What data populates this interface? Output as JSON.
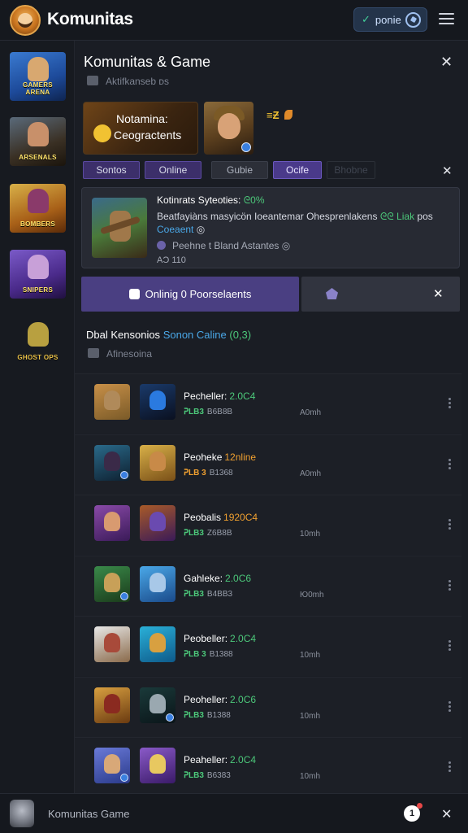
{
  "app": {
    "brand_name": "Komunitas",
    "pill_label": "ponie",
    "pill_check": "✓",
    "accent": "#4a3f82",
    "green": "#4cc87a",
    "blue": "#4aa8e8",
    "orange": "#f0a030"
  },
  "rail": {
    "items": [
      {
        "caption": "GAMERS ARENA",
        "icon": "game-thumb-icon"
      },
      {
        "caption": "ARSENALS",
        "icon": "soldier-thumb-icon"
      },
      {
        "caption": "BOMBERS",
        "icon": "warrior-thumb-icon"
      },
      {
        "caption": "SNIPERS",
        "icon": "knight-thumb-icon"
      },
      {
        "caption": "GHOST OPS",
        "icon": "mascot-thumb-icon"
      }
    ]
  },
  "panel": {
    "title": "Komunitas & Game",
    "subtitle": "Aktifkanseb ᴅs",
    "banner_line1": "Notamina:",
    "banner_line2": "Ceogractents",
    "hero_tags": "≡Ƶ",
    "chips": [
      "Sontos",
      "Online",
      "Gubie",
      "Ocife",
      "Bhobne"
    ],
    "feature": {
      "title_pre": "Kotinrats Syteoties:",
      "title_hl": "ᘓ0%",
      "desc_pre": "Beatfayiàns masyicön Ioeantemar Ohesprenlakens",
      "desc_hl": "ᘓᘓ Liak",
      "desc_mid": "pos",
      "desc_link": "Coeaent",
      "desc_tail": "◎",
      "meta": "Peehne t Bland Astantes ◎",
      "count": "AƆ 110"
    },
    "cta_label": "Onlinig 0 Poorselaents",
    "list_head_pre": "Dbal Kensonios",
    "list_head_blue": "Sonon Caline",
    "list_head_green": "(0,3)",
    "list_sub": "Afinesoina"
  },
  "list": {
    "rows": [
      {
        "name": "Pecheller:",
        "status": "2.0C4",
        "status_color": "#4cc87a",
        "v1": "ᕈLB3",
        "v2": "B6B8B",
        "time": "A0mh"
      },
      {
        "name": "Peoheke",
        "status": "12nline",
        "status_color": "#f0a030",
        "v1": "ᕈLB 3",
        "v2": "B1368",
        "time": "A0mh"
      },
      {
        "name": "Peobalis",
        "status": "1920C4",
        "status_color": "#f0a030",
        "v1": "ᕈLB3",
        "v2": "Z6B8B",
        "time": "10mh"
      },
      {
        "name": "Gahleke:",
        "status": "2.0C6",
        "status_color": "#4cc87a",
        "v1": "ᕈLB3",
        "v2": "B4BB3",
        "time": "Ю0mh"
      },
      {
        "name": "Peobeller:",
        "status": "2.0C4",
        "status_color": "#4cc87a",
        "v1": "ᕈLB 3",
        "v2": "B1388",
        "time": "10mh"
      },
      {
        "name": "Peoheller:",
        "status": "2.0C6",
        "status_color": "#4cc87a",
        "v1": "ᕈLB3",
        "v2": "B1388",
        "time": "10mh"
      },
      {
        "name": "Peaheller:",
        "status": "2.0C4",
        "status_color": "#4cc87a",
        "v1": "ᕈLB3",
        "v2": "B6383",
        "time": "10mh"
      }
    ]
  },
  "bottom": {
    "label": "Komunitas Game",
    "badge": "1"
  }
}
